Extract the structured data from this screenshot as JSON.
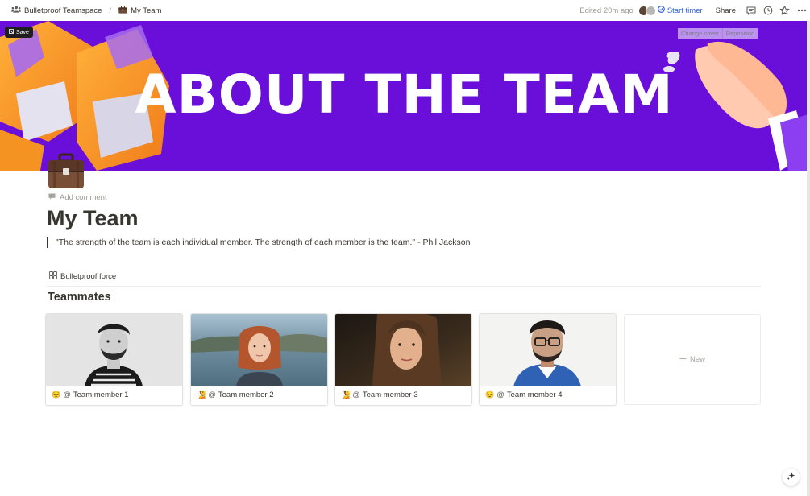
{
  "breadcrumb": {
    "workspace": "Bulletproof Teamspace",
    "separator": "/",
    "page": "My Team"
  },
  "topbar": {
    "edited": "Edited 20m ago",
    "start_timer": "Start timer",
    "share": "Share",
    "icons": [
      "comments-icon",
      "history-icon",
      "favorite-star-icon",
      "more-icon"
    ]
  },
  "cover": {
    "title": "ABOUT THE TEAM",
    "save_label": "Save",
    "change_cover": "Change cover",
    "reposition": "Reposition",
    "background_color": "#6a0fd9"
  },
  "page": {
    "icon": "briefcase-icon",
    "add_comment": "Add comment",
    "title": "My Team",
    "quote": "\"The strength of the team is each individual member. The strength of each member is the team.\" - Phil Jackson"
  },
  "database": {
    "view_label": "Bulletproof force",
    "section_title": "Teammates",
    "cards": [
      {
        "emoji": "😌",
        "at": "@",
        "name": "Team member 1"
      },
      {
        "emoji": "🧏",
        "at": "@",
        "name": "Team member 2"
      },
      {
        "emoji": "🧏",
        "at": "@",
        "name": "Team member 3"
      },
      {
        "emoji": "😌",
        "at": "@",
        "name": "Team member 4"
      }
    ],
    "new_label": "New"
  }
}
